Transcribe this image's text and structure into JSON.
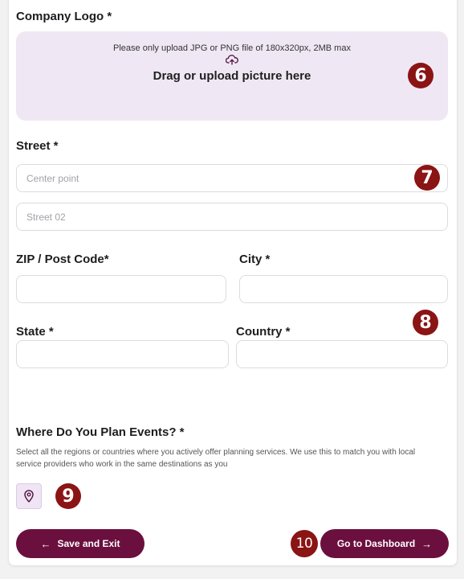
{
  "logo": {
    "label": "Company Logo *",
    "hint": "Please only upload JPG or PNG file of 180x320px, 2MB max",
    "cta": "Drag or upload picture here",
    "icon": "upload-cloud-icon"
  },
  "street": {
    "label": "Street *",
    "line1_placeholder": "Center point",
    "line2_placeholder": "Street 02"
  },
  "zip": {
    "label": "ZIP / Post Code*"
  },
  "city": {
    "label": "City *"
  },
  "state": {
    "label": "State *"
  },
  "country": {
    "label": "Country *"
  },
  "events": {
    "label": "Where Do You Plan Events? *",
    "description": "Select all the regions or countries where you actively offer planning services. We use this to match you with local service providers who work in the same destinations as you",
    "icon": "map-pin-icon"
  },
  "actions": {
    "save_label": "Save and Exit",
    "save_icon": "←",
    "dashboard_label": "Go to Dashboard",
    "dashboard_icon": "→"
  },
  "markers": {
    "m6": "6",
    "m7": "7",
    "m8": "8",
    "m9": "9",
    "m10": "10"
  },
  "colors": {
    "accent": "#6b0f3e",
    "marker": "#8b1414",
    "upload_bg": "#efe8f4"
  }
}
